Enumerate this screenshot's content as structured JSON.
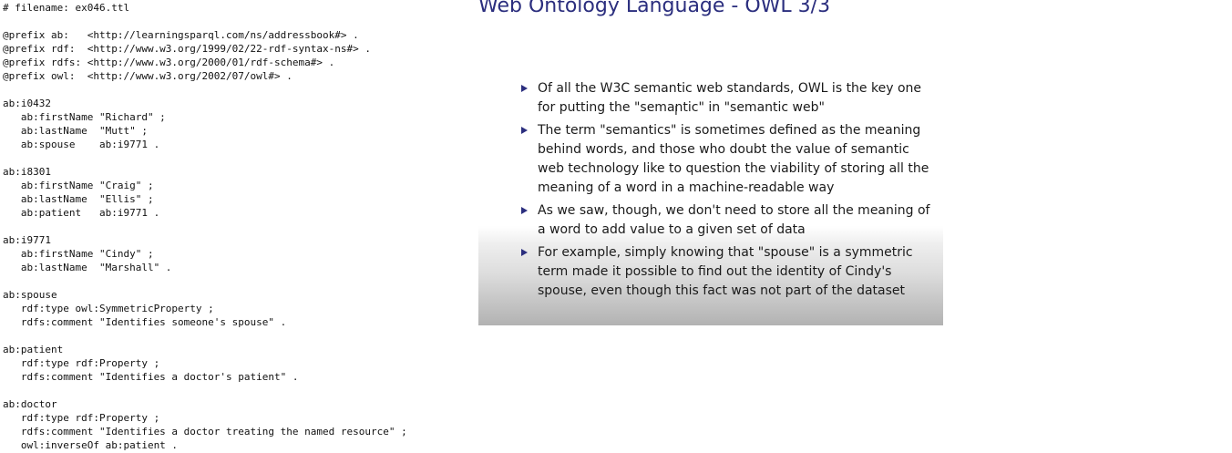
{
  "code_editor": {
    "lines": [
      "# filename: ex046.ttl",
      "",
      "@prefix ab:   <http://learningsparql.com/ns/addressbook#> .",
      "@prefix rdf:  <http://www.w3.org/1999/02/22-rdf-syntax-ns#> .",
      "@prefix rdfs: <http://www.w3.org/2000/01/rdf-schema#> .",
      "@prefix owl:  <http://www.w3.org/2002/07/owl#> .",
      "",
      "ab:i0432",
      "   ab:firstName \"Richard\" ;",
      "   ab:lastName  \"Mutt\" ;",
      "   ab:spouse    ab:i9771 .",
      "",
      "ab:i8301",
      "   ab:firstName \"Craig\" ;",
      "   ab:lastName  \"Ellis\" ;",
      "   ab:patient   ab:i9771 .",
      "",
      "ab:i9771",
      "   ab:firstName \"Cindy\" ;",
      "   ab:lastName  \"Marshall\" .",
      "",
      "ab:spouse",
      "   rdf:type owl:SymmetricProperty ;",
      "   rdfs:comment \"Identifies someone's spouse\" .",
      "",
      "ab:patient",
      "   rdf:type rdf:Property ;",
      "   rdfs:comment \"Identifies a doctor's patient\" .",
      "",
      "ab:doctor",
      "   rdf:type rdf:Property ;",
      "   rdfs:comment \"Identifies a doctor treating the named resource\" ;",
      "   owl:inverseOf ab:patient ."
    ]
  },
  "slide": {
    "title": "Web Ontology Language - OWL 3/3",
    "bullets": [
      "Of all the W3C semantic web standards, OWL is the key one for putting the \"semantic\" in \"semantic web\"",
      "The term \"semantics\" is sometimes defined as the meaning behind words, and those who doubt the value of semantic web technology like to question the viability of storing all the meaning of a word in a machine-readable way",
      "As we saw, though, we don't need to store all the meaning of a word to add value to a given set of data",
      "For example, simply knowing that \"spouse\" is a symmetric term made it possible to find out the identity of Cindy's spouse, even though this fact was not part of the dataset"
    ],
    "bullet_color": "#2b2e7e",
    "title_color": "#2b2e7e"
  },
  "cursor": {
    "icon": "text-cursor-icon",
    "glyph": "I"
  }
}
